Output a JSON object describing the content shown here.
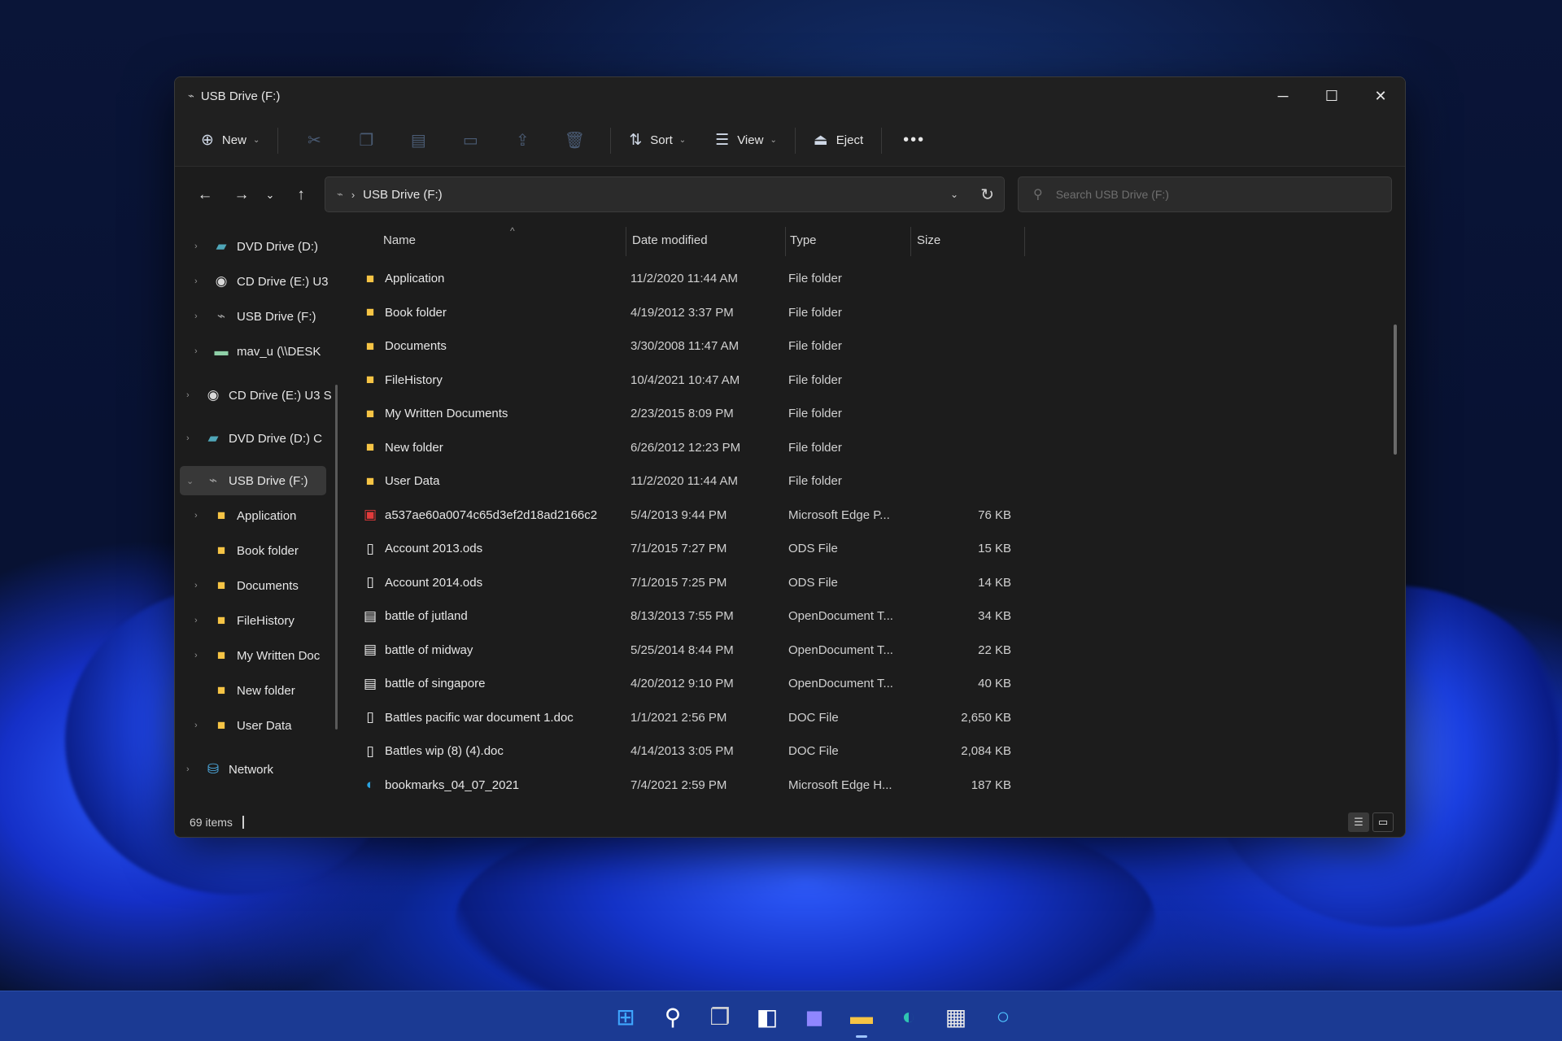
{
  "window": {
    "title": "USB Drive (F:)",
    "controls": {
      "minimize": "─",
      "maximize": "☐",
      "close": "✕"
    }
  },
  "toolbar": {
    "new_label": "New",
    "sort_label": "Sort",
    "view_label": "View",
    "eject_label": "Eject",
    "more_label": "•••"
  },
  "address": {
    "path": "USB Drive (F:)",
    "search_placeholder": "Search USB Drive (F:)"
  },
  "sidebar": {
    "items": [
      {
        "label": "DVD Drive (D:) ",
        "icon": "dvd-drive-icon",
        "expandable": true
      },
      {
        "label": "CD Drive (E:) U3",
        "icon": "cd-drive-icon",
        "expandable": true
      },
      {
        "label": "USB Drive (F:)",
        "icon": "usb-drive-icon",
        "expandable": true
      },
      {
        "label": "mav_u (\\\\DESK",
        "icon": "network-drive-icon",
        "expandable": true
      },
      {
        "label": "CD Drive (E:) U3 S",
        "icon": "cd-drive-icon",
        "expandable": true
      },
      {
        "label": "DVD Drive (D:) C",
        "icon": "dvd-drive-icon",
        "expandable": true
      },
      {
        "label": "USB Drive (F:)",
        "icon": "usb-drive-icon",
        "expandable": true,
        "selected": true
      },
      {
        "label": "Application",
        "icon": "folder-icon",
        "expandable": true
      },
      {
        "label": "Book folder",
        "icon": "folder-icon",
        "expandable": false
      },
      {
        "label": "Documents",
        "icon": "folder-icon",
        "expandable": true
      },
      {
        "label": "FileHistory",
        "icon": "folder-icon",
        "expandable": true
      },
      {
        "label": "My Written Doc",
        "icon": "folder-icon",
        "expandable": true
      },
      {
        "label": "New folder",
        "icon": "folder-icon",
        "expandable": false
      },
      {
        "label": "User Data",
        "icon": "folder-icon",
        "expandable": true
      },
      {
        "label": "Network",
        "icon": "network-icon",
        "expandable": true
      }
    ]
  },
  "columns": {
    "name": "Name",
    "date": "Date modified",
    "type": "Type",
    "size": "Size"
  },
  "files": [
    {
      "name": "Application",
      "date": "11/2/2020 11:44 AM",
      "type": "File folder",
      "size": "",
      "icon": "folder-icon"
    },
    {
      "name": "Book folder",
      "date": "4/19/2012 3:37 PM",
      "type": "File folder",
      "size": "",
      "icon": "folder-icon"
    },
    {
      "name": "Documents",
      "date": "3/30/2008 11:47 AM",
      "type": "File folder",
      "size": "",
      "icon": "folder-icon"
    },
    {
      "name": "FileHistory",
      "date": "10/4/2021 10:47 AM",
      "type": "File folder",
      "size": "",
      "icon": "folder-icon"
    },
    {
      "name": "My Written Documents",
      "date": "2/23/2015 8:09 PM",
      "type": "File folder",
      "size": "",
      "icon": "folder-icon"
    },
    {
      "name": "New folder",
      "date": "6/26/2012 12:23 PM",
      "type": "File folder",
      "size": "",
      "icon": "folder-icon"
    },
    {
      "name": "User Data",
      "date": "11/2/2020 11:44 AM",
      "type": "File folder",
      "size": "",
      "icon": "folder-icon"
    },
    {
      "name": "a537ae60a0074c65d3ef2d18ad2166c2",
      "date": "5/4/2013 9:44 PM",
      "type": "Microsoft Edge P...",
      "size": "76 KB",
      "icon": "pdf-file-icon"
    },
    {
      "name": "Account 2013.ods",
      "date": "7/1/2015 7:27 PM",
      "type": "ODS File",
      "size": "15 KB",
      "icon": "file-icon"
    },
    {
      "name": "Account 2014.ods",
      "date": "7/1/2015 7:25 PM",
      "type": "ODS File",
      "size": "14 KB",
      "icon": "file-icon"
    },
    {
      "name": "battle of jutland",
      "date": "8/13/2013 7:55 PM",
      "type": "OpenDocument T...",
      "size": "34 KB",
      "icon": "document-icon"
    },
    {
      "name": "battle of midway",
      "date": "5/25/2014 8:44 PM",
      "type": "OpenDocument T...",
      "size": "22 KB",
      "icon": "document-icon"
    },
    {
      "name": "battle of singapore",
      "date": "4/20/2012 9:10 PM",
      "type": "OpenDocument T...",
      "size": "40 KB",
      "icon": "document-icon"
    },
    {
      "name": "Battles pacific war document 1.doc",
      "date": "1/1/2021 2:56 PM",
      "type": "DOC File",
      "size": "2,650 KB",
      "icon": "file-icon"
    },
    {
      "name": "Battles wip (8) (4).doc",
      "date": "4/14/2013 3:05 PM",
      "type": "DOC File",
      "size": "2,084 KB",
      "icon": "file-icon"
    },
    {
      "name": "bookmarks_04_07_2021",
      "date": "7/4/2021 2:59 PM",
      "type": "Microsoft Edge H...",
      "size": "187 KB",
      "icon": "edge-file-icon"
    }
  ],
  "status": {
    "item_count": "69 items"
  },
  "taskbar": {
    "items": [
      "start-icon",
      "search-icon",
      "task-view-icon",
      "widgets-icon",
      "chat-icon",
      "file-explorer-icon",
      "edge-icon",
      "store-icon",
      "cortana-icon"
    ]
  },
  "colors": {
    "folder": "#f6c445",
    "accent": "#1b3a93",
    "window_bg": "#1c1c1c"
  }
}
